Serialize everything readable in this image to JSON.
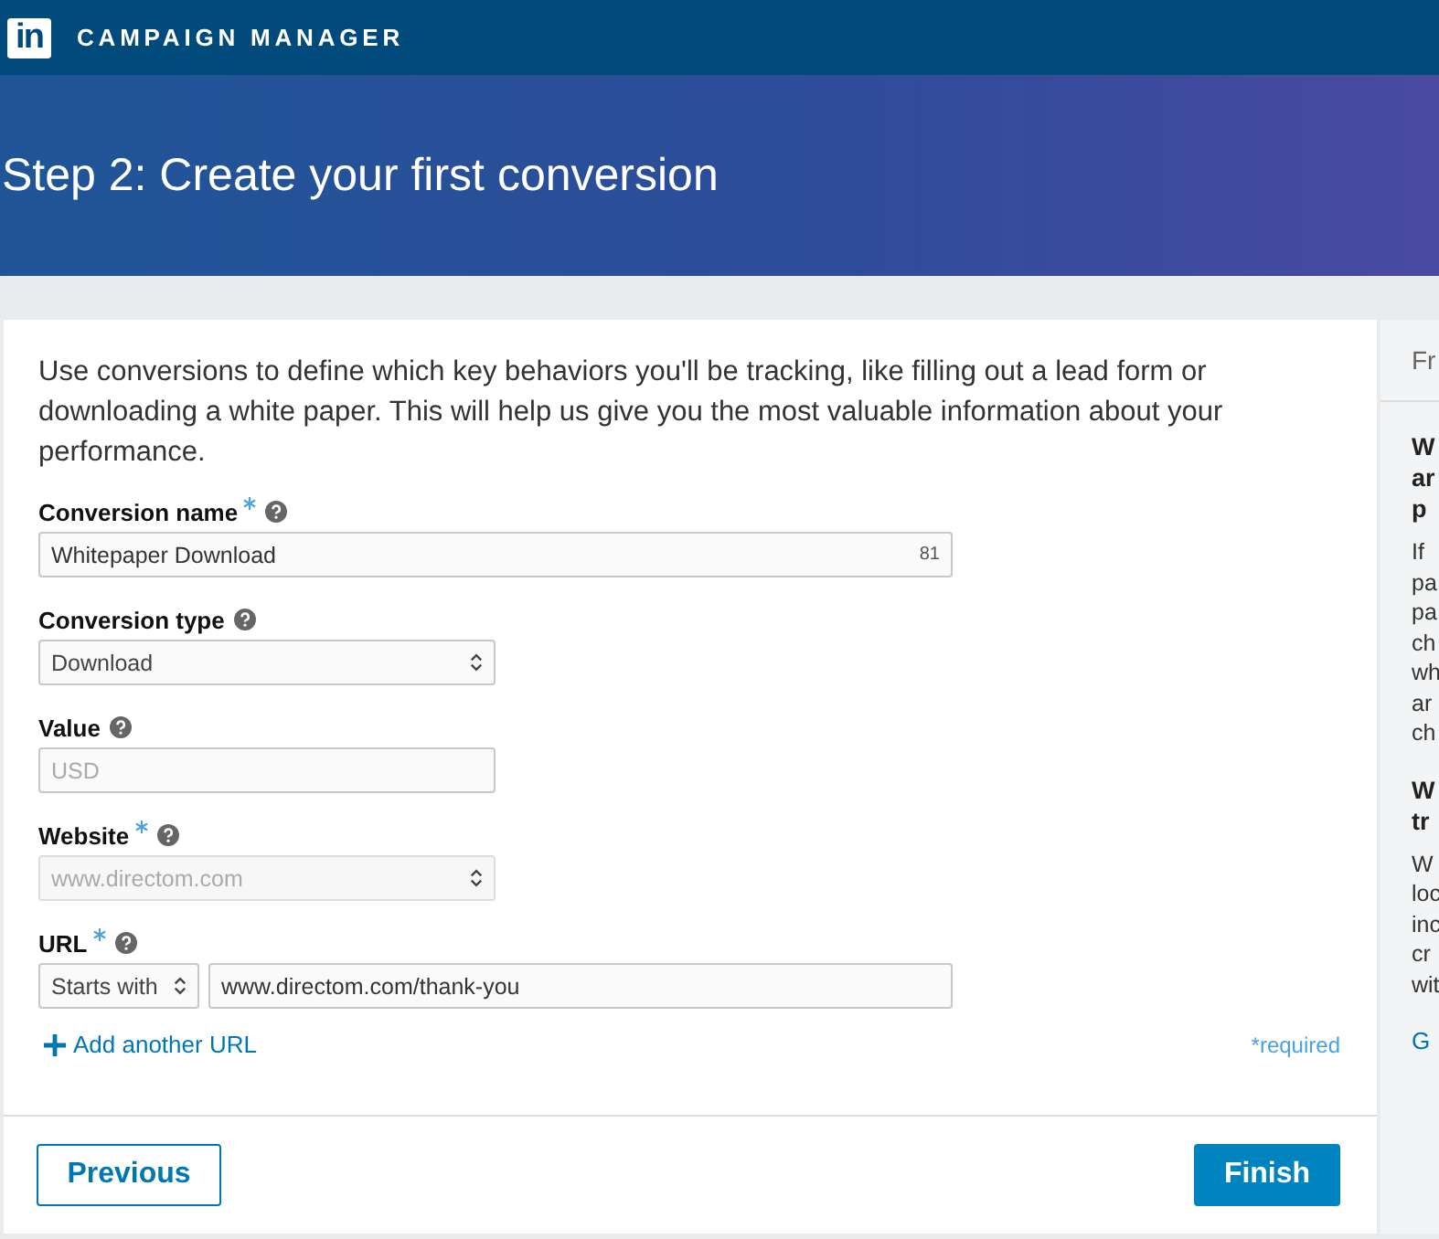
{
  "header": {
    "logo": "in",
    "title": "CAMPAIGN MANAGER"
  },
  "banner": {
    "title": "Step 2: Create your first conversion"
  },
  "intro": "Use conversions to define which key behaviors you'll be tracking, like filling out a lead form or downloading a white paper. This will help us give you the most valuable information about your performance.",
  "fields": [
    {
      "kind": "text",
      "label": "Conversion name",
      "required": true,
      "value": "Whitepaper Download",
      "counter": "81",
      "disabled": false
    },
    {
      "kind": "select",
      "label": "Conversion type",
      "required": false,
      "value": "Download",
      "disabled": false
    },
    {
      "kind": "text",
      "label": "Value",
      "required": false,
      "placeholder": "USD",
      "disabled": false
    },
    {
      "kind": "select",
      "label": "Website",
      "required": true,
      "value": "www.directom.com",
      "disabled": true
    },
    {
      "kind": "url",
      "label": "URL",
      "required": true,
      "match": "Starts with",
      "value": "www.directom.com/thank-you",
      "disabled": false
    }
  ],
  "add_link": "Add another URL",
  "required_note": "*required",
  "buttons": {
    "previous": "Previous",
    "finish": "Finish"
  },
  "side_panel": {
    "header": "Fr",
    "sections": [
      {
        "heading": [
          "W",
          "ar",
          "p"
        ],
        "body": [
          "If",
          "pa",
          "pa",
          "ch",
          "wh",
          "ar",
          "ch"
        ]
      },
      {
        "heading": [
          "W",
          "tr"
        ],
        "body": [
          "W",
          "loc",
          "inc",
          "cr",
          "wit"
        ]
      }
    ],
    "link": "G"
  }
}
